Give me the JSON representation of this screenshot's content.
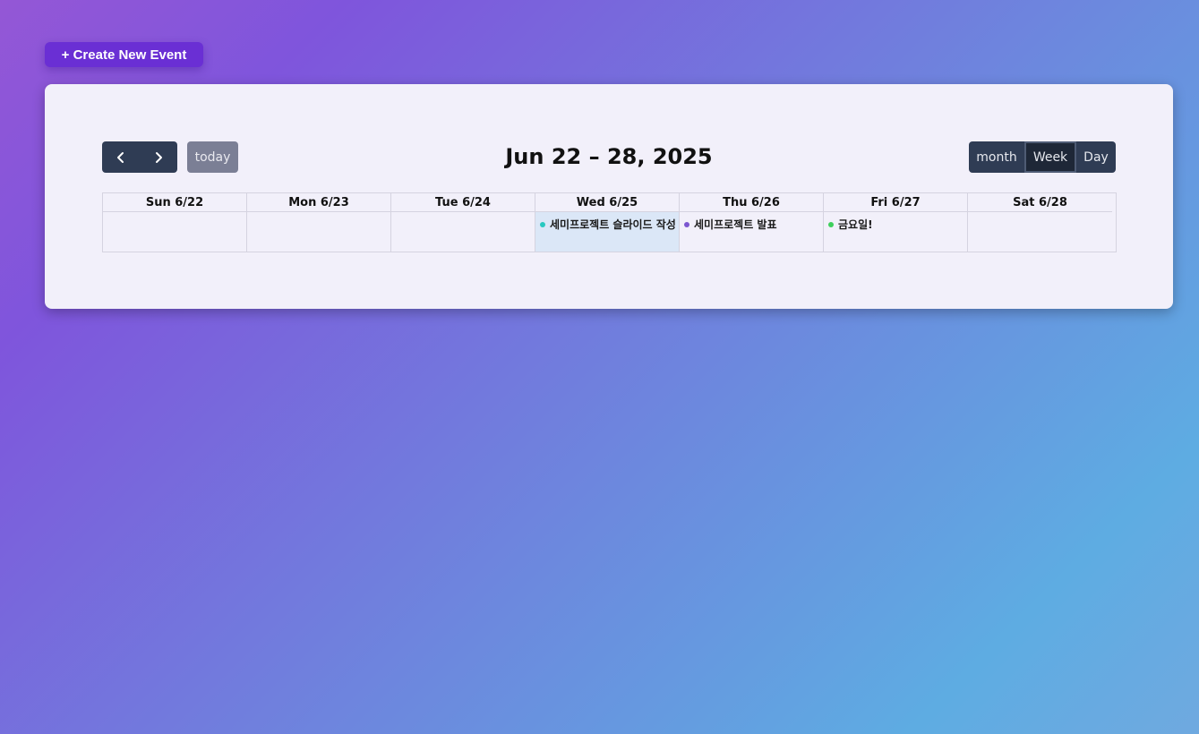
{
  "create_button": {
    "label": "+ Create New Event"
  },
  "toolbar": {
    "title": "Jun 22 – 28, 2025",
    "prev_icon": "chevron-left-icon",
    "next_icon": "chevron-right-icon",
    "today_label": "today",
    "views": [
      {
        "label": "month",
        "active": false
      },
      {
        "label": "Week",
        "active": true
      },
      {
        "label": "Day",
        "active": false
      }
    ]
  },
  "days": [
    {
      "label": "Sun 6/22",
      "events": []
    },
    {
      "label": "Mon 6/23",
      "events": []
    },
    {
      "label": "Tue 6/24",
      "events": []
    },
    {
      "label": "Wed 6/25",
      "today": true,
      "events": [
        {
          "title": "세미프로젝트 슬라이드 작성",
          "color": "#27c8c0"
        }
      ]
    },
    {
      "label": "Thu 6/26",
      "events": [
        {
          "title": "세미프로젝트 발표",
          "color": "#7b56d0"
        }
      ]
    },
    {
      "label": "Fri 6/27",
      "events": [
        {
          "title": "금요일!",
          "color": "#3ecf5c"
        }
      ]
    },
    {
      "label": "Sat 6/28",
      "events": []
    }
  ],
  "colors": {
    "accent": "#6a2fd4",
    "toolbar_button": "#2f3c54",
    "today_highlight": "#dbe7f7"
  }
}
